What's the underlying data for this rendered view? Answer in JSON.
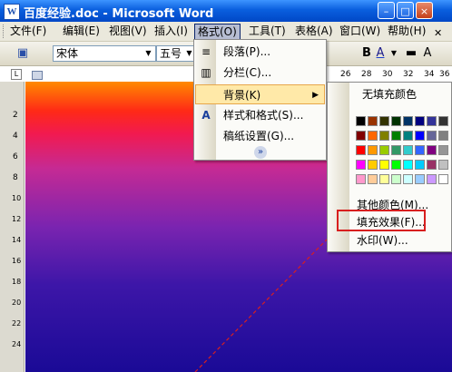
{
  "window": {
    "title": "百度经验.doc - Microsoft Word",
    "app_icon_letter": "W",
    "minimize": "–",
    "maximize": "□",
    "close": "×"
  },
  "menubar": {
    "items": [
      "文件(F)",
      "编辑(E)",
      "视图(V)",
      "插入(I)",
      "格式(O)",
      "工具(T)",
      "表格(A)",
      "窗口(W)",
      "帮助(H)"
    ]
  },
  "toolbar": {
    "font_name": "宋体",
    "font_size": "五号",
    "bold": "B",
    "font_color_label": "A"
  },
  "ruler": {
    "numbers": [
      "26",
      "28",
      "30",
      "32",
      "34",
      "36"
    ],
    "corner": "L"
  },
  "left_ruler": {
    "numbers": [
      "2",
      "4",
      "6",
      "8",
      "10",
      "12",
      "14",
      "16",
      "18",
      "20",
      "22",
      "24"
    ]
  },
  "format_menu": {
    "items": [
      {
        "label": "段落(P)...",
        "icon": "paragraph-icon"
      },
      {
        "label": "分栏(C)...",
        "icon": "columns-icon"
      },
      {
        "label": "背景(K)",
        "icon": "",
        "has_submenu": true
      },
      {
        "label": "样式和格式(S)...",
        "icon": "styles-icon"
      },
      {
        "label": "稿纸设置(G)...",
        "icon": ""
      }
    ],
    "expand": "»"
  },
  "background_submenu": {
    "no_fill": "无填充颜色",
    "swatch_colors": [
      [
        "#000000",
        "#993300",
        "#333300",
        "#003300",
        "#003366",
        "#000080",
        "#333399",
        "#333333"
      ],
      [
        "#800000",
        "#ff6600",
        "#808000",
        "#008000",
        "#008080",
        "#0000ff",
        "#666699",
        "#808080"
      ],
      [
        "#ff0000",
        "#ff9900",
        "#99cc00",
        "#339966",
        "#33cccc",
        "#3366ff",
        "#800080",
        "#969696"
      ],
      [
        "#ff00ff",
        "#ffcc00",
        "#ffff00",
        "#00ff00",
        "#00ffff",
        "#00ccff",
        "#993366",
        "#c0c0c0"
      ],
      [
        "#ff99cc",
        "#ffcc99",
        "#ffff99",
        "#ccffcc",
        "#ccffff",
        "#99ccff",
        "#cc99ff",
        "#ffffff"
      ]
    ],
    "more_colors": "其他颜色(M)...",
    "fill_effects": "填充效果(F)...",
    "watermark": "水印(W)..."
  },
  "colors": {
    "highlight_border": "#d81f1f",
    "menu_hover": "#ffe9a8"
  }
}
